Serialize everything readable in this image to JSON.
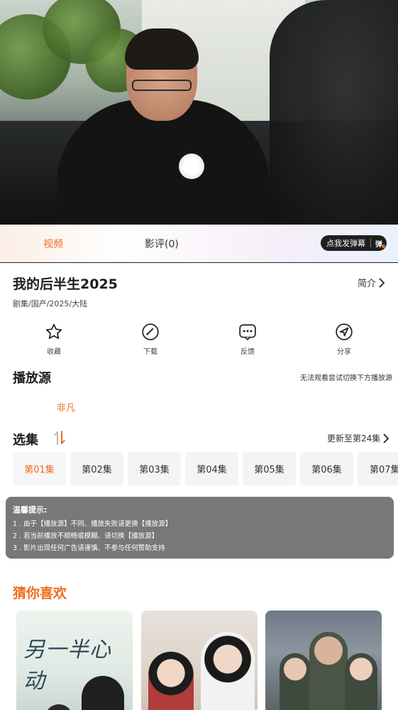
{
  "player": {
    "tabs": [
      {
        "label": "视频"
      },
      {
        "label": "影评(0)"
      }
    ],
    "danmu_button": {
      "label": "点我发弹幕",
      "icon_text": "弹"
    }
  },
  "show": {
    "title": "我的后半生2025",
    "intro_link": "简介",
    "meta": "剧集/国产/2025/大陆"
  },
  "actions": [
    {
      "label": "收藏",
      "icon": "star-icon"
    },
    {
      "label": "下载",
      "icon": "download-gauge-icon"
    },
    {
      "label": "反馈",
      "icon": "feedback-icon"
    },
    {
      "label": "分享",
      "icon": "share-icon"
    }
  ],
  "source": {
    "title": "播放源",
    "hint": "无法观看尝试切换下方播放源",
    "items": [
      {
        "label": "非凡",
        "active": true
      }
    ]
  },
  "episodes": {
    "title": "选集",
    "update_text": "更新至第24集",
    "items": [
      "第01集",
      "第02集",
      "第03集",
      "第04集",
      "第05集",
      "第06集",
      "第07集"
    ],
    "active_index": 0
  },
  "tips": {
    "title": "温馨提示:",
    "lines": [
      "1 . 由于【播放源】不同、播放失败请更换【播放源】",
      "2 . 若当前播放不顺畅或模糊、请切换【播放源】",
      "3 . 影片出现任何广告请谨慎、不参与任何赞助支持"
    ]
  },
  "recommend": {
    "title": "猜你喜欢",
    "posters": [
      {
        "title_art": "另一半心动"
      },
      {
        "title_art": ""
      },
      {
        "title_art": ""
      }
    ]
  },
  "colors": {
    "accent": "#f26b1d",
    "tips_bg": "#777878",
    "episode_bg": "#f4f4f6"
  }
}
